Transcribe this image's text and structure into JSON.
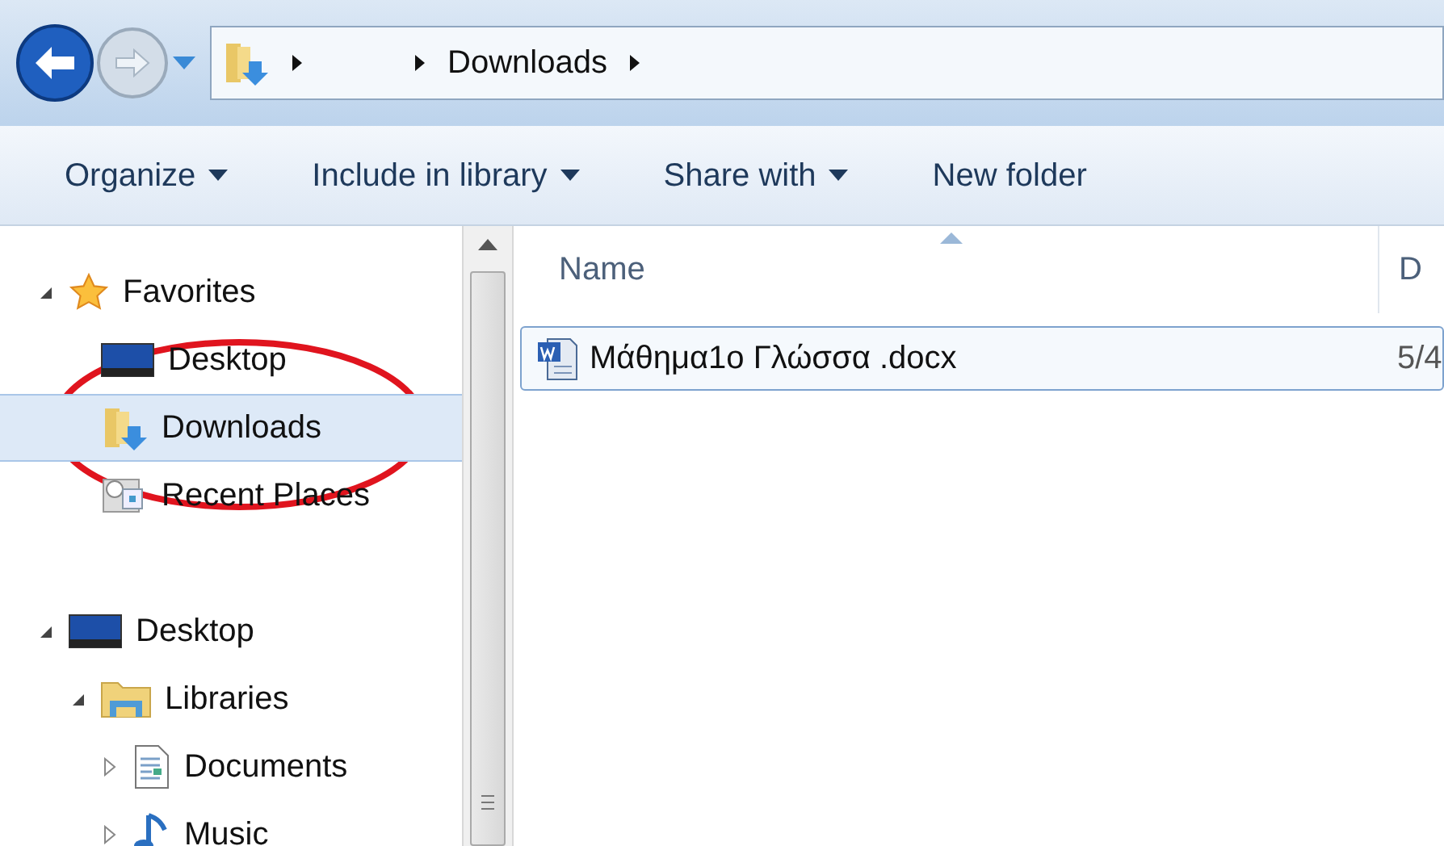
{
  "address_bar": {
    "crumbs": [
      "Downloads"
    ]
  },
  "toolbar": [
    {
      "label": "Organize",
      "dropdown": true
    },
    {
      "label": "Include in library",
      "dropdown": true
    },
    {
      "label": "Share with",
      "dropdown": true
    },
    {
      "label": "New folder",
      "dropdown": false
    }
  ],
  "navigation": [
    {
      "label": "Favorites",
      "kind": "star",
      "expanded": true,
      "selected": false,
      "children": [
        {
          "label": "Desktop",
          "kind": "desktop",
          "selected": false
        },
        {
          "label": "Downloads",
          "kind": "download",
          "selected": true
        },
        {
          "label": "Recent Places",
          "kind": "recent",
          "selected": false
        }
      ]
    },
    {
      "label": "Desktop",
      "kind": "desktop",
      "expanded": true,
      "selected": false,
      "children": [
        {
          "label": "Libraries",
          "kind": "library",
          "expanded": true,
          "selected": false,
          "children": [
            {
              "label": "Documents",
              "kind": "documents",
              "expanded": false,
              "selected": false
            },
            {
              "label": "Music",
              "kind": "music",
              "expanded": false,
              "selected": false
            }
          ]
        }
      ]
    }
  ],
  "columns": [
    "Name",
    "D"
  ],
  "files": [
    {
      "name": "Μάθημα1ο Γλώσσα .docx",
      "date": "5/4",
      "selected": true
    }
  ]
}
